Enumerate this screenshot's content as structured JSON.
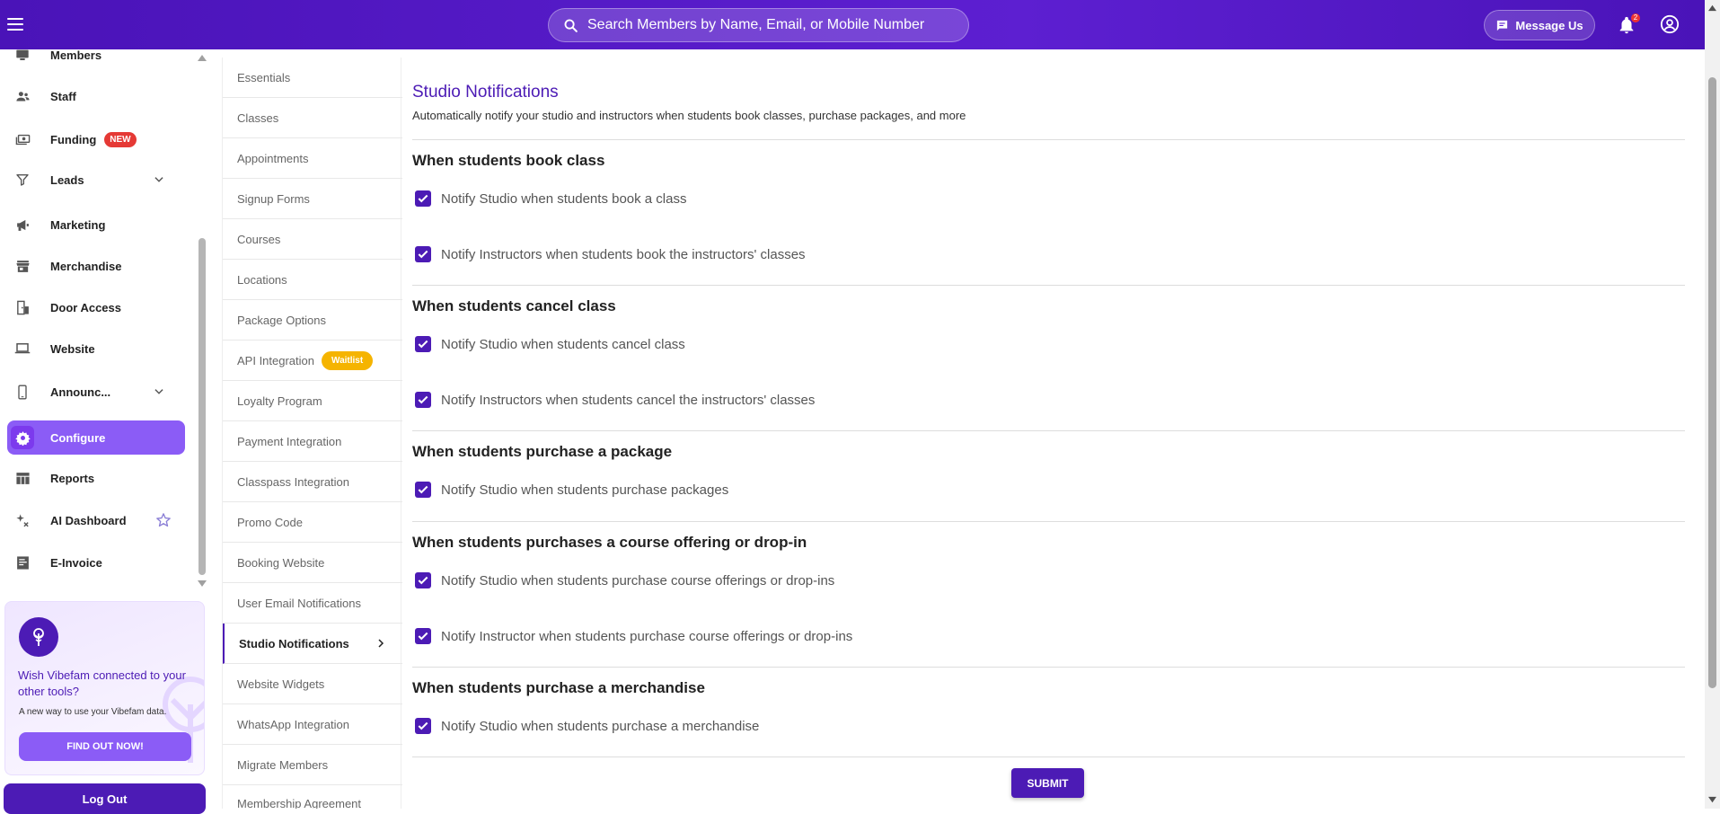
{
  "topbar": {
    "search_placeholder": "Search Members by Name, Email, or Mobile Number",
    "message_label": "Message Us",
    "notification_count": "2"
  },
  "sidebar": {
    "items": [
      {
        "label": "Members",
        "icon": "members-icon"
      },
      {
        "label": "Staff",
        "icon": "staff-icon"
      },
      {
        "label": "Funding",
        "icon": "funding-icon",
        "badge": "NEW"
      },
      {
        "label": "Leads",
        "icon": "filter-icon",
        "expandable": true
      },
      {
        "label": "Marketing",
        "icon": "megaphone-icon"
      },
      {
        "label": "Merchandise",
        "icon": "store-icon"
      },
      {
        "label": "Door Access",
        "icon": "door-access-icon"
      },
      {
        "label": "Website",
        "icon": "laptop-icon"
      },
      {
        "label": "Announc...",
        "icon": "phone-icon",
        "expandable": true
      },
      {
        "label": "Configure",
        "icon": "gear-icon",
        "active": true
      },
      {
        "label": "Reports",
        "icon": "table-icon"
      },
      {
        "label": "AI Dashboard",
        "icon": "ai-sparkle-icon"
      },
      {
        "label": "E-Invoice",
        "icon": "invoice-icon"
      }
    ],
    "promo": {
      "title": "Wish Vibefam connected to your other tools?",
      "subtitle": "A new way to use your Vibefam data.",
      "button": "FIND OUT NOW!"
    },
    "logout_label": "Log Out"
  },
  "submenu": {
    "items": [
      {
        "label": "Essentials"
      },
      {
        "label": "Classes"
      },
      {
        "label": "Appointments"
      },
      {
        "label": "Signup Forms"
      },
      {
        "label": "Courses"
      },
      {
        "label": "Locations"
      },
      {
        "label": "Package Options"
      },
      {
        "label": "API Integration",
        "badge": "Waitlist"
      },
      {
        "label": "Loyalty Program"
      },
      {
        "label": "Payment Integration"
      },
      {
        "label": "Classpass Integration"
      },
      {
        "label": "Promo Code"
      },
      {
        "label": "Booking Website"
      },
      {
        "label": "User Email Notifications"
      },
      {
        "label": "Studio Notifications",
        "active": true
      },
      {
        "label": "Website Widgets"
      },
      {
        "label": "WhatsApp Integration"
      },
      {
        "label": "Migrate Members"
      },
      {
        "label": "Membership Agreement"
      }
    ]
  },
  "main": {
    "title": "Studio Notifications",
    "subtitle": "Automatically notify your studio and instructors when students book classes, purchase packages, and more",
    "sections": [
      {
        "heading": "When students book class",
        "options": [
          {
            "label": "Notify Studio when students book a class",
            "checked": true
          },
          {
            "label": "Notify Instructors when students book the instructors' classes",
            "checked": true
          }
        ]
      },
      {
        "heading": "When students cancel class",
        "options": [
          {
            "label": "Notify Studio when students cancel class",
            "checked": true
          },
          {
            "label": "Notify Instructors when students cancel the instructors' classes",
            "checked": true
          }
        ]
      },
      {
        "heading": "When students purchase a package",
        "options": [
          {
            "label": "Notify Studio when students purchase packages",
            "checked": true
          }
        ]
      },
      {
        "heading": "When students purchases a course offering or drop-in",
        "options": [
          {
            "label": "Notify Studio when students purchase course offerings or drop-ins",
            "checked": true
          },
          {
            "label": "Notify Instructor when students purchase course offerings or drop-ins",
            "checked": true
          }
        ]
      },
      {
        "heading": "When students purchase a merchandise",
        "options": [
          {
            "label": "Notify Studio when students purchase a merchandise",
            "checked": true
          }
        ]
      }
    ],
    "submit_label": "SUBMIT"
  },
  "colors": {
    "brand": "#4c1bb5",
    "accent": "#8b5cf6",
    "new_badge": "#e53935",
    "waitlist_badge": "#f5b400"
  }
}
